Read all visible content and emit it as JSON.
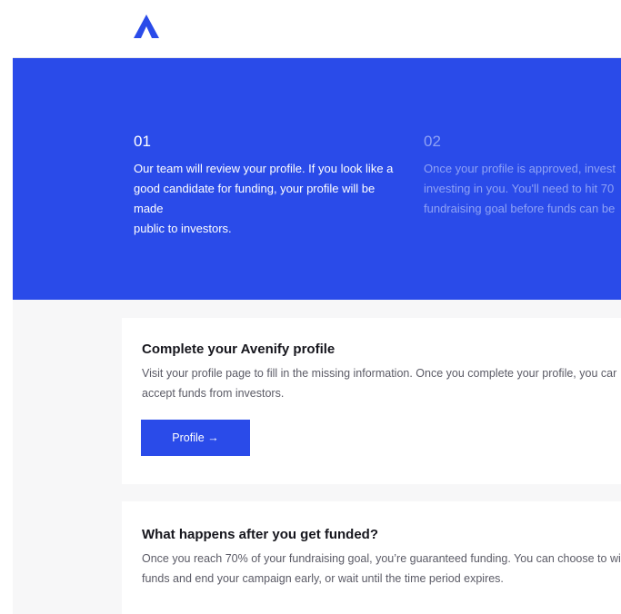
{
  "brand": {
    "logo_icon": "avenify-logo-icon",
    "color": "#2a4be9"
  },
  "steps": [
    {
      "number": "01",
      "lines": [
        "Our team will review your profile. If you look like a",
        "good candidate for funding, your profile will be made",
        "public to investors."
      ]
    },
    {
      "number": "02",
      "lines": [
        "Once your profile is approved, invest",
        "investing in you. You'll need to hit 70",
        "fundraising goal before funds can be"
      ]
    }
  ],
  "cards": {
    "profile": {
      "title": "Complete your Avenify profile",
      "text": "Visit your profile page to fill in the missing information. Once you complete your profile, you car accept funds from investors.",
      "button_label": "Profile →"
    },
    "funded": {
      "title": "What happens after you get funded?",
      "text": "Once you reach 70% of your fundraising goal, you’re guaranteed funding. You can choose to wi funds and end your campaign early, or wait until the time period expires."
    }
  }
}
